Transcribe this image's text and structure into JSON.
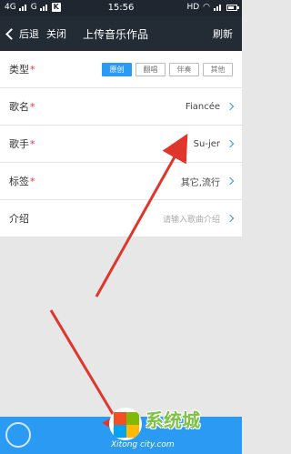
{
  "status": {
    "network_1": "4G",
    "network_2": "G",
    "badge": "K",
    "time": "15:56",
    "wifi": "HD"
  },
  "nav": {
    "back_label": "后退",
    "close_label": "关闭",
    "title": "上传音乐作品",
    "refresh_label": "刷新"
  },
  "form": {
    "type_label": "类型",
    "type_options": [
      "原创",
      "翻唱",
      "伴奏",
      "其他"
    ],
    "type_selected": "原创",
    "song_label": "歌名",
    "song_value": "Fiancée",
    "singer_label": "歌手",
    "singer_value": "Su-jer",
    "tags_label": "标签",
    "tags_value": "其它,流行",
    "intro_label": "介绍",
    "intro_placeholder": "请输入歌曲介绍",
    "required_mark": "*"
  },
  "watermark": {
    "text": "系统城",
    "url": "Xitong city.com"
  },
  "colors": {
    "accent": "#2b9af3",
    "nav_bg": "#232b35",
    "annotation_arrow": "#e0352b"
  }
}
